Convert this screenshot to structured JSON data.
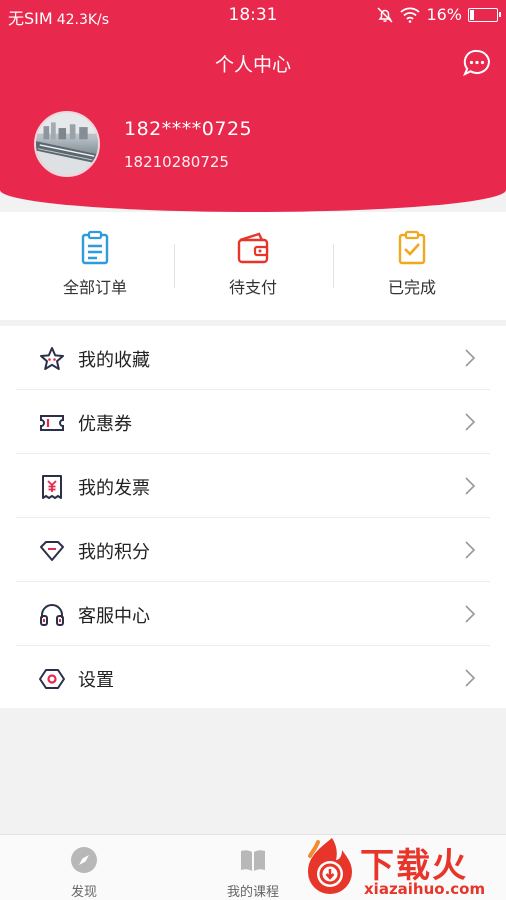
{
  "status_bar": {
    "carrier": "无SIM",
    "speed": "42.3K/s",
    "time": "18:31",
    "battery": "16%"
  },
  "header": {
    "title": "个人中心",
    "message_icon": "chat-bubble-icon",
    "background_color": "#e8294d"
  },
  "profile": {
    "masked_phone": "182****0725",
    "phone": "18210280725"
  },
  "orders": [
    {
      "label": "全部订单",
      "icon": "clipboard-icon",
      "color": "#2f9bd9"
    },
    {
      "label": "待支付",
      "icon": "wallet-icon",
      "color": "#e8352a"
    },
    {
      "label": "已完成",
      "icon": "clipboard-check-icon",
      "color": "#f0a81c"
    }
  ],
  "menu": [
    {
      "label": "我的收藏",
      "icon": "star-icon"
    },
    {
      "label": "优惠券",
      "icon": "ticket-icon"
    },
    {
      "label": "我的发票",
      "icon": "invoice-icon"
    },
    {
      "label": "我的积分",
      "icon": "diamond-icon"
    },
    {
      "label": "客服中心",
      "icon": "headphones-icon"
    },
    {
      "label": "设置",
      "icon": "settings-icon"
    }
  ],
  "tabbar": [
    {
      "label": "发现",
      "icon": "compass-icon"
    },
    {
      "label": "我的课程",
      "icon": "book-icon"
    }
  ],
  "watermark": {
    "brand": "下载火",
    "url": "xiazaihuo.com"
  }
}
